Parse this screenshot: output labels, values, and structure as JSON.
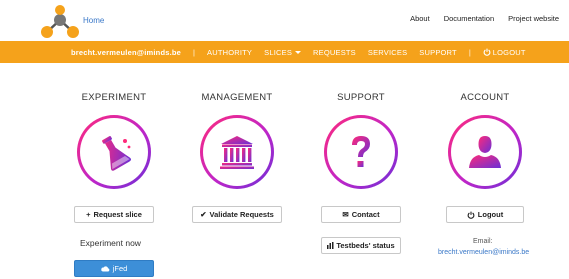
{
  "header": {
    "home_label": "Home",
    "links": [
      "About",
      "Documentation",
      "Project website"
    ]
  },
  "nav": {
    "user_email": "brecht.vermeulen@iminds.be",
    "separator": "|",
    "authority": "AUTHORITY",
    "slices": "SLICES",
    "requests": "REQUESTS",
    "services": "SERVICES",
    "support": "SUPPORT",
    "logout": "LOGOUT"
  },
  "colors": {
    "nav_bg": "#f5a21b",
    "icon_gradient_start": "#ff2a7a",
    "icon_gradient_end": "#6b2fd6",
    "link_blue": "#3a78c8",
    "button_blue": "#3d8fd8"
  },
  "columns": {
    "experiment": {
      "title": "EXPERIMENT",
      "icon": "flask-icon",
      "button": "Request slice",
      "subtitle": "Experiment now",
      "jfed_button": "jFed"
    },
    "management": {
      "title": "MANAGEMENT",
      "icon": "institution-icon",
      "button": "Validate Requests"
    },
    "support": {
      "title": "SUPPORT",
      "icon": "question-icon",
      "contact_button": "Contact",
      "status_button": "Testbeds' status"
    },
    "account": {
      "title": "ACCOUNT",
      "icon": "user-icon",
      "button": "Logout",
      "email_label": "Email:",
      "email_value": "brecht.vermeulen@iminds.be"
    }
  }
}
